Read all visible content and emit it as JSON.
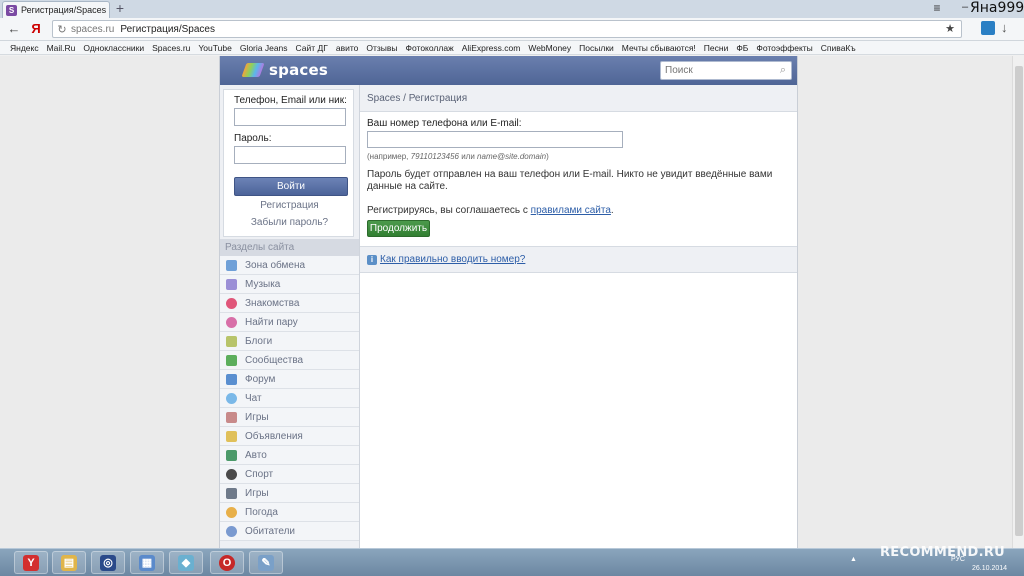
{
  "browser": {
    "tab_title": "Регистрация/Spaces",
    "favicon_letter": "S",
    "new_tab_symbol": "+",
    "menu_symbol": "≡",
    "minimize_symbol": "–",
    "user_name": "Яна999",
    "back_symbol": "←",
    "yandex_symbol": "Я",
    "url_domain": "spaces.ru",
    "url_title": "Регистрация/Spaces",
    "star_symbol": "★",
    "download_symbol": "↓"
  },
  "bookmarks": [
    "Яндекс",
    "Mail.Ru",
    "Одноклассники",
    "Spaces.ru",
    "YouTube",
    "Gloria Jeans",
    "Сайт ДГ",
    "авито",
    "Отзывы",
    "Фотоколлаж",
    "AliExpress.com",
    "WebMoney",
    "Посылки",
    "Мечты сбываются!",
    "Песни",
    "ФБ",
    "Фотоэффекты",
    "СпиваКъ"
  ],
  "site": {
    "logo": "spaces",
    "search_placeholder": "Поиск",
    "login": {
      "phone_label": "Телефон, Email или ник:",
      "password_label": "Пароль:",
      "login_button": "Войти",
      "register_link": "Регистрация",
      "forgot_link": "Забыли пароль?"
    },
    "sections_header": "Разделы сайта",
    "sections": [
      {
        "label": "Зона обмена",
        "icon": "exchange-icon",
        "color": "#6fa0d8"
      },
      {
        "label": "Музыка",
        "icon": "music-icon",
        "color": "#9b8fd6"
      },
      {
        "label": "Знакомства",
        "icon": "heart-icon",
        "color": "#e0567a"
      },
      {
        "label": "Найти пару",
        "icon": "hearts-icon",
        "color": "#d86fa8"
      },
      {
        "label": "Блоги",
        "icon": "pencil-icon",
        "color": "#b8c46a"
      },
      {
        "label": "Сообщества",
        "icon": "people-icon",
        "color": "#5cae5c"
      },
      {
        "label": "Форум",
        "icon": "forum-icon",
        "color": "#5a8fd0"
      },
      {
        "label": "Чат",
        "icon": "chat-icon",
        "color": "#7ab8e8"
      },
      {
        "label": "Игры",
        "icon": "swords-icon",
        "color": "#c88a8a"
      },
      {
        "label": "Объявления",
        "icon": "ads-icon",
        "color": "#e0c05a"
      },
      {
        "label": "Авто",
        "icon": "car-icon",
        "color": "#4c9a6a"
      },
      {
        "label": "Спорт",
        "icon": "ball-icon",
        "color": "#4a4a4a"
      },
      {
        "label": "Игры",
        "icon": "gamepad-icon",
        "color": "#6f7a8a"
      },
      {
        "label": "Погода",
        "icon": "weather-icon",
        "color": "#e8b04a"
      },
      {
        "label": "Обитатели",
        "icon": "user-icon",
        "color": "#7a9ad0"
      }
    ],
    "breadcrumb": "Spaces / Регистрация",
    "form": {
      "phone_label": "Ваш номер телефона или E-mail:",
      "hint_prefix": "(например, ",
      "hint_phone": "79110123456",
      "hint_or": " или ",
      "hint_email": "name@site.domain",
      "hint_suffix": ")",
      "info_text": "Пароль будет отправлен на ваш телефон или E-mail. Никто не увидит введённые вами данные на сайте.",
      "agree_text": "Регистрируясь, вы соглашаетесь с ",
      "agree_link": "правилами сайта",
      "agree_end": ".",
      "continue_button": "Продолжить"
    },
    "help_icon_letter": "i",
    "help_link": "Как правильно вводить номер?"
  },
  "taskbar": {
    "apps": [
      {
        "name": "yandex-browser-icon",
        "glyph": "Y",
        "color": "#d32f2f"
      },
      {
        "name": "file-explorer-icon",
        "glyph": "▤",
        "color": "#e0b54a"
      },
      {
        "name": "app-icon",
        "glyph": "◎",
        "color": "#2a4a8a"
      },
      {
        "name": "picture-viewer-icon",
        "glyph": "▦",
        "color": "#5a8acb"
      },
      {
        "name": "notes-app-icon",
        "glyph": "◆",
        "color": "#6ab0d0"
      },
      {
        "name": "opera-icon",
        "glyph": "O",
        "color": "#c62828"
      },
      {
        "name": "paint-icon",
        "glyph": "✎",
        "color": "#7aa0c8"
      }
    ],
    "watermark": "RECOMMEND.RU",
    "tray_lang": "РУС",
    "date": "26.10.2014"
  }
}
